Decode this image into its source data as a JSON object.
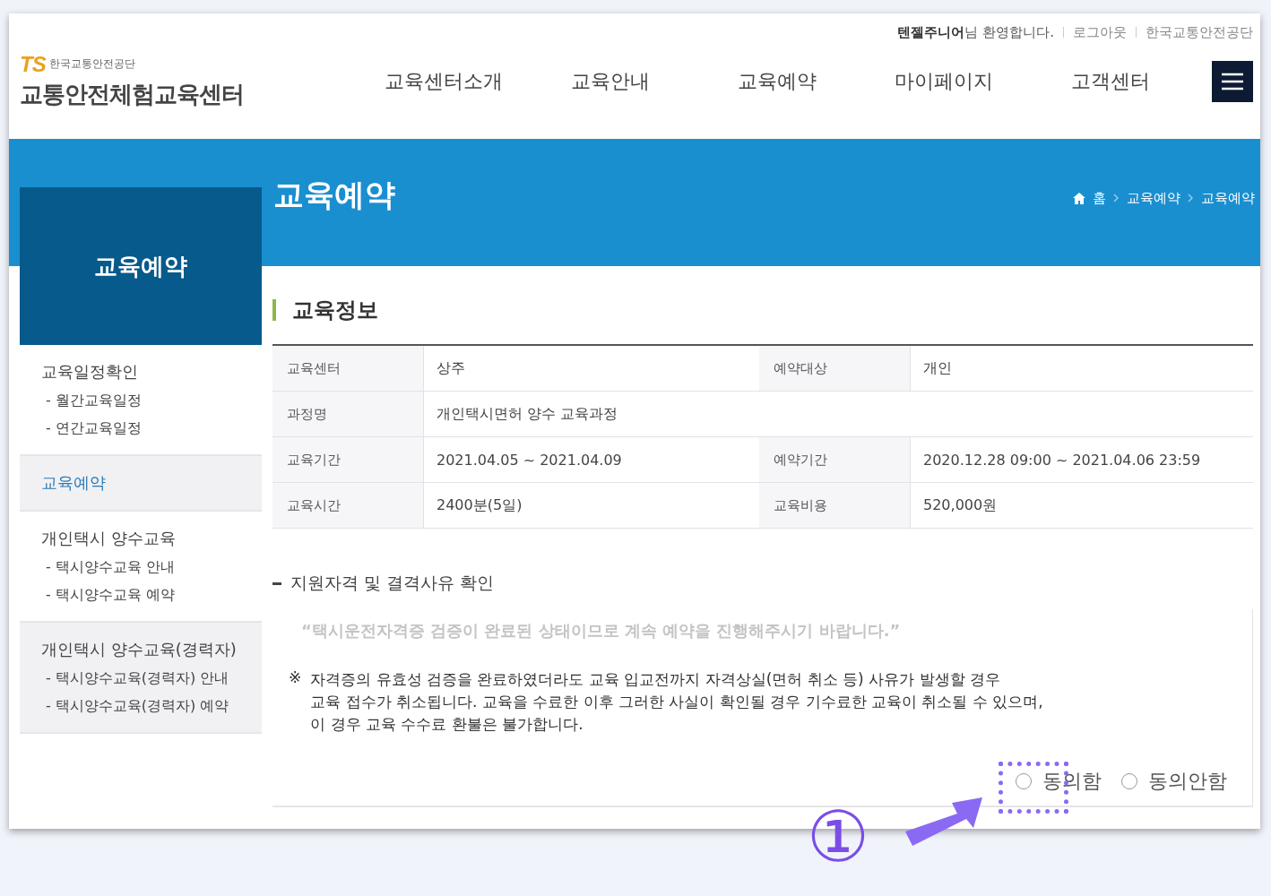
{
  "header": {
    "logo_mark": "TS",
    "logo_org": "한국교통안전공단",
    "site_title": "교통안전체험교육센터",
    "user_name": "텐젤주니어",
    "welcome": "님 환영합니다.",
    "util_links": [
      "로그아웃",
      "한국교통안전공단"
    ],
    "nav": [
      {
        "label": "교육센터소개",
        "selected": false
      },
      {
        "label": "교육안내",
        "selected": false
      },
      {
        "label": "교육예약",
        "selected": false
      },
      {
        "label": "마이페이지",
        "selected": false
      },
      {
        "label": "고객센터",
        "selected": false
      }
    ]
  },
  "banner": {
    "title": "교육예약",
    "breadcrumb": [
      "홈",
      "교육예약",
      "교육예약"
    ]
  },
  "sidebar": {
    "title": "교육예약",
    "groups": [
      {
        "label": "교육일정확인",
        "selected": false,
        "shaded": false,
        "children": [
          {
            "label": "- 월간교육일정"
          },
          {
            "label": "- 연간교육일정"
          }
        ]
      },
      {
        "label": "교육예약",
        "selected": true,
        "shaded": true
      },
      {
        "label": "개인택시 양수교육",
        "selected": false,
        "shaded": false,
        "children": [
          {
            "label": "- 택시양수교육 안내"
          },
          {
            "label": "- 택시양수교육 예약"
          }
        ]
      },
      {
        "label": "개인택시 양수교육(경력자)",
        "selected": false,
        "shaded": true,
        "children": [
          {
            "label": "- 택시양수교육(경력자) 안내"
          },
          {
            "label": "- 택시양수교육(경력자) 예약"
          }
        ]
      }
    ]
  },
  "section_title": "교육정보",
  "table": {
    "rows": [
      [
        {
          "label": "교육센터",
          "value": "상주"
        },
        {
          "label": "예약대상",
          "value": "개인"
        }
      ],
      [
        {
          "label": "과정명",
          "value": "개인택시면허 양수 교육과정"
        }
      ],
      [
        {
          "label": "교육기간",
          "value": "2021.04.05 ~ 2021.04.09"
        },
        {
          "label": "예약기간",
          "value": "2020.12.28 09:00 ~ 2021.04.06 23:59"
        }
      ],
      [
        {
          "label": "교육시간",
          "value": "2400분(5일)"
        },
        {
          "label": "교육비용",
          "value": "520,000원"
        }
      ]
    ]
  },
  "subsection": {
    "title": "지원자격 및 결격사유 확인",
    "quote": "“택시운전자격증 검증이 완료된 상태이므로 계속 예약을 진행해주시기 바랍니다.”",
    "note_mark": "※",
    "note_lines": [
      "자격증의 유효성 검증을 완료하였더라도 교육 입교전까지 자격상실(면허 취소 등) 사유가 발생할 경우",
      "교육 접수가 취소됩니다. 교육을 수료한 이후 그러한 사실이 확인될 경우 기수료한 교육이 취소될 수 있으며,",
      "이 경우 교육 수수료 환불은 불가합니다."
    ],
    "options": [
      {
        "label": "동의함",
        "selected": false
      },
      {
        "label": "동의안함",
        "selected": false
      }
    ]
  },
  "annotation": {
    "step": "①"
  }
}
